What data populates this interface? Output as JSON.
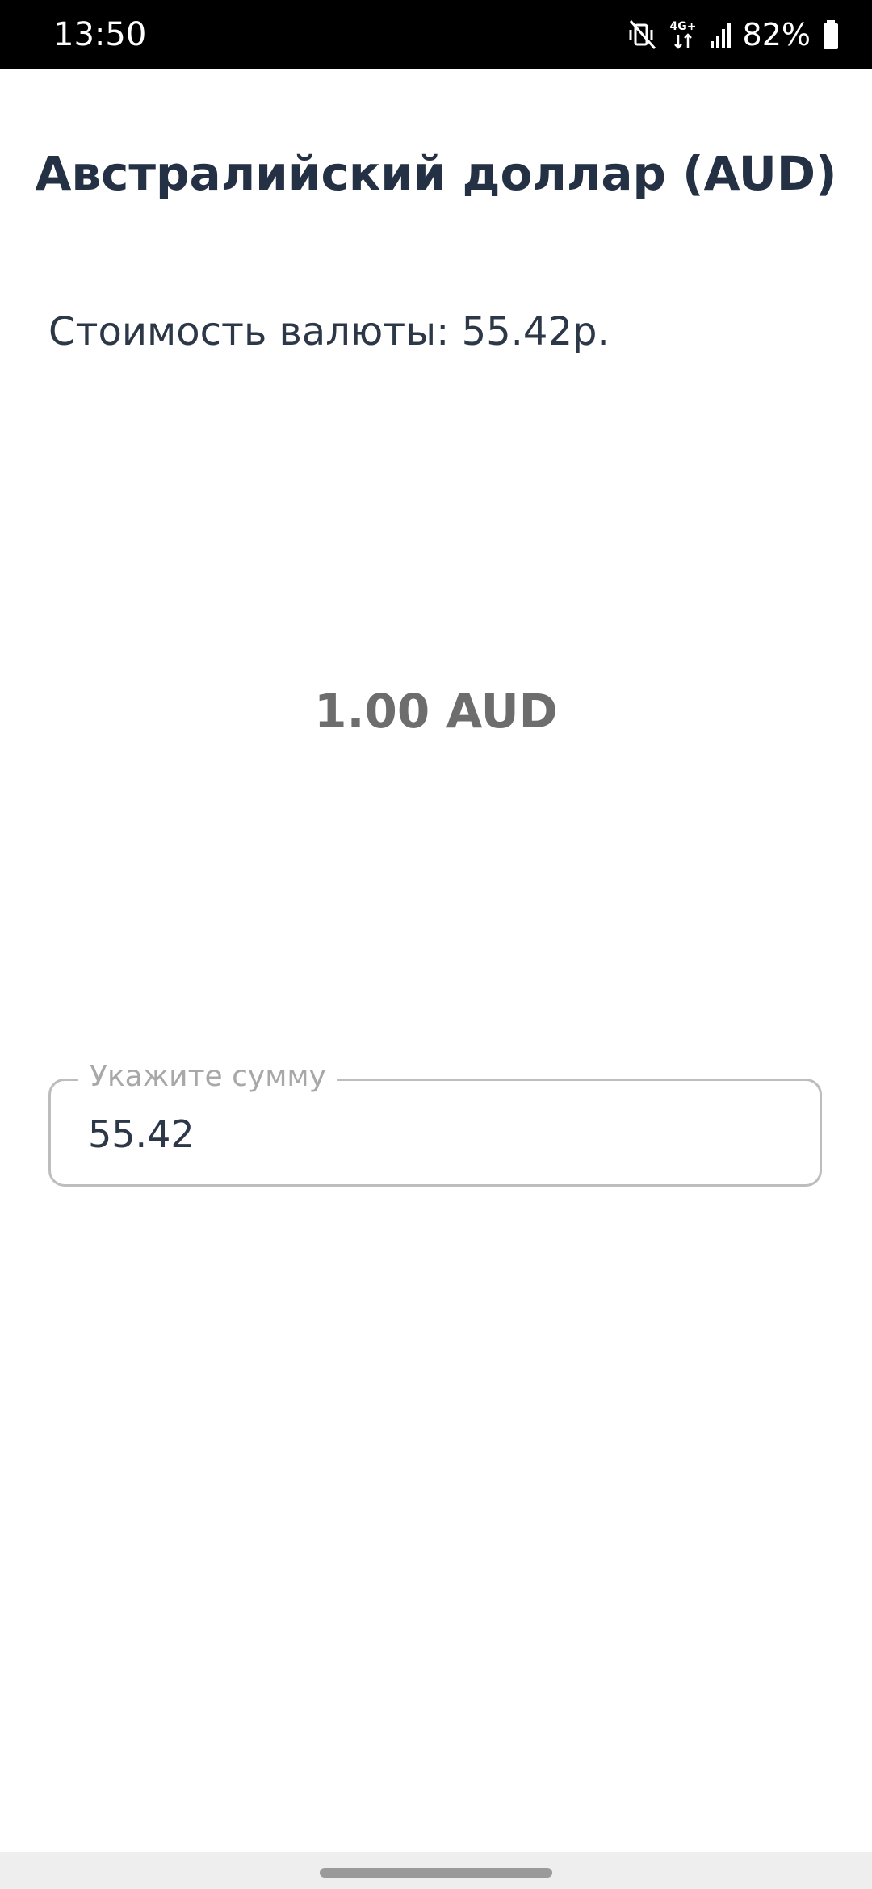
{
  "status_bar": {
    "time": "13:50",
    "network_label": "4G+",
    "battery_percent": "82%",
    "icons": [
      "mute-vibrate-icon",
      "network-4g-icon",
      "signal-icon",
      "battery-icon"
    ]
  },
  "screen": {
    "title": "Австралийский доллар (AUD)",
    "rate_text": "Стоимость валюты: 55.42р.",
    "converted_amount": "1.00 AUD"
  },
  "amount_field": {
    "label": "Укажите сумму",
    "value": "55.42"
  },
  "colors": {
    "title": "#243044",
    "body_text": "#2c3848",
    "converted": "#6d6d6d",
    "field_border": "#bdbdbd",
    "field_label": "#a8a8a8",
    "status_bar_bg": "#000000"
  }
}
